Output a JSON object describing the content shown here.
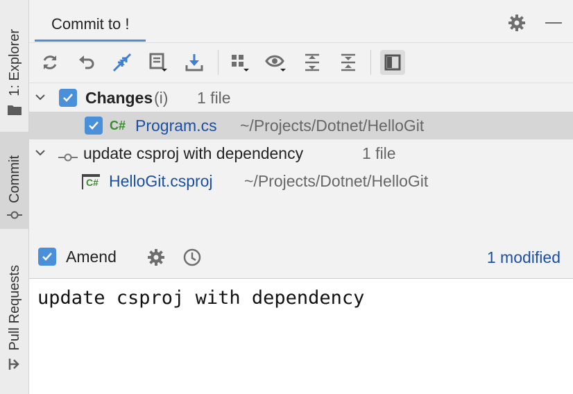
{
  "sidebar": {
    "explorer_label": "1: Explorer",
    "commit_label": "Commit",
    "pull_requests_label": "Pull Requests"
  },
  "header": {
    "tab_label": "Commit to !"
  },
  "changes": {
    "group_label": "Changes",
    "info_marker": "(i)",
    "count": "1 file",
    "files": [
      {
        "lang_badge": "C#",
        "name": "Program.cs",
        "path": "~/Projects/Dotnet/HelloGit"
      }
    ]
  },
  "commit": {
    "message": "update csproj with dependency",
    "count": "1 file",
    "files": [
      {
        "lang_badge": "C#",
        "name": "HelloGit.csproj",
        "path": "~/Projects/Dotnet/HelloGit"
      }
    ]
  },
  "amend": {
    "label": "Amend",
    "checked": true,
    "status": "1 modified"
  },
  "message_editor": {
    "text": "update csproj with dependency"
  },
  "icons": [
    "folder-icon",
    "commit-node-icon",
    "pull-request-icon",
    "gear-icon",
    "minimize-icon",
    "refresh-icon",
    "undo-icon",
    "merge-icon",
    "shelve-icon",
    "download-icon",
    "group-by-icon",
    "eye-icon",
    "expand-all-icon",
    "collapse-all-icon",
    "preview-panel-icon",
    "history-icon"
  ],
  "colors": {
    "accent": "#4a8fd9",
    "file_link": "#1a4fa8",
    "csharp_badge": "#3a8a2e"
  }
}
